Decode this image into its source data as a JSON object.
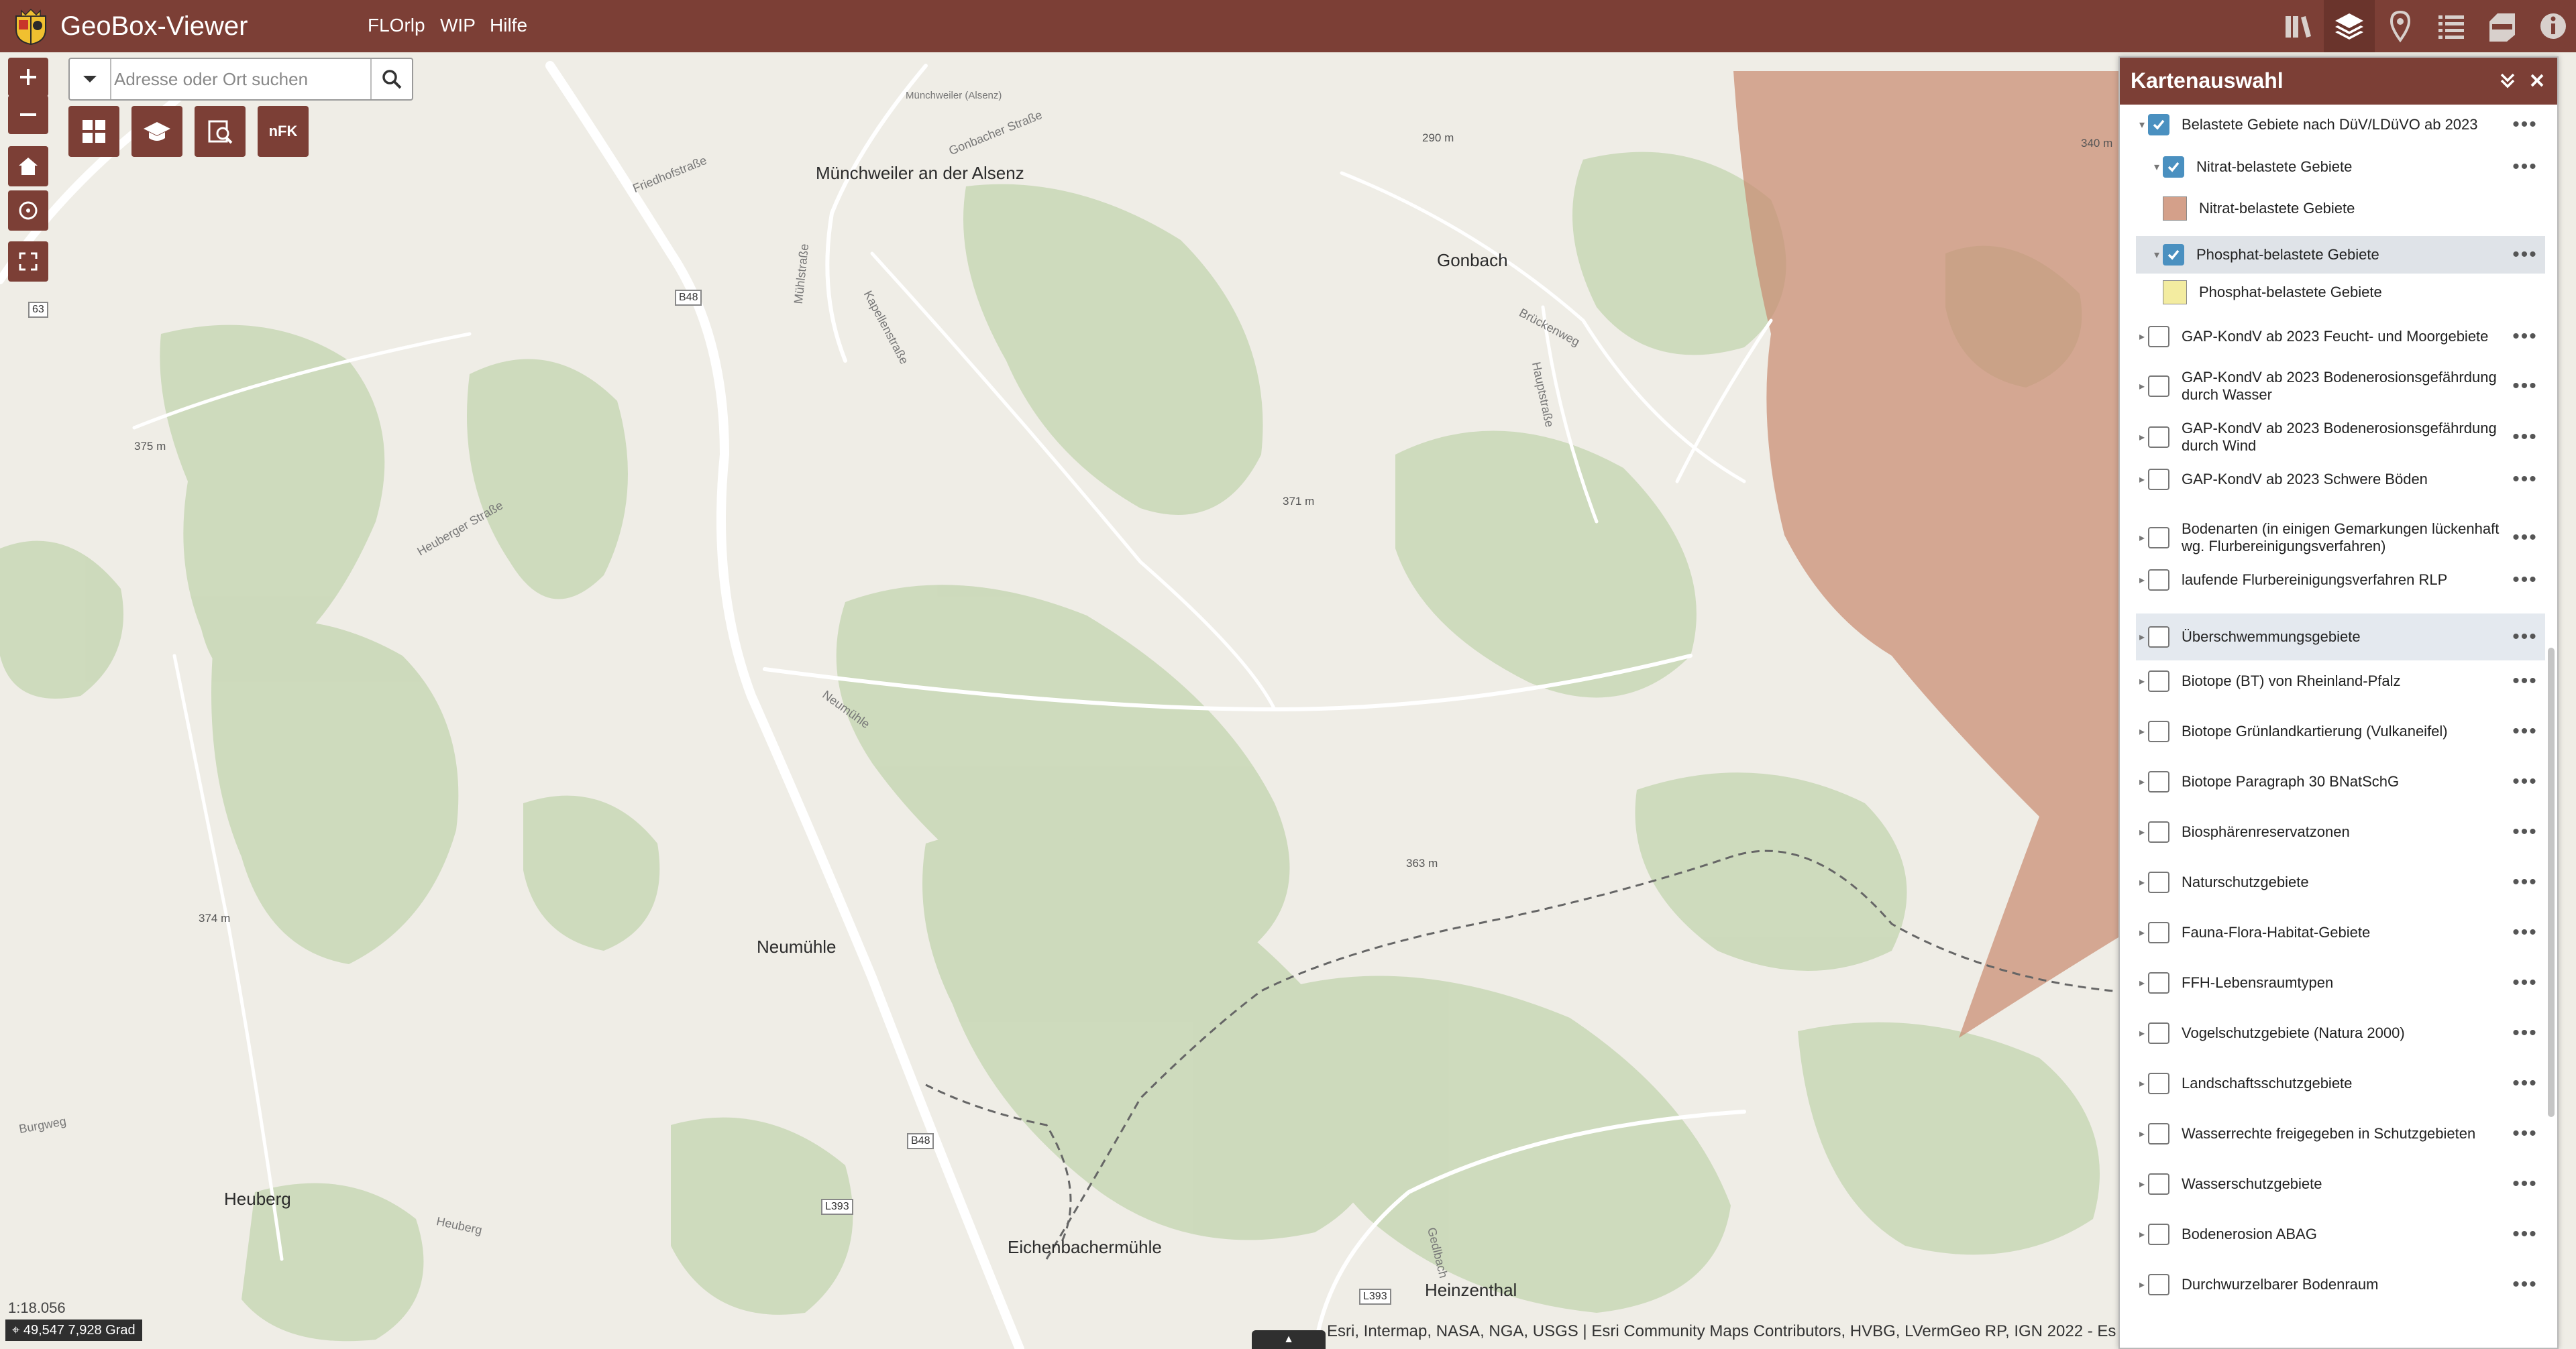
{
  "header": {
    "title": "GeoBox-Viewer",
    "menu": [
      "FLOrlp",
      "WIP",
      "Hilfe"
    ],
    "icons": [
      "library-icon",
      "layers-icon",
      "location-pin-icon",
      "legend-list-icon",
      "print-icon",
      "info-icon"
    ]
  },
  "search": {
    "placeholder": "Adresse oder Ort suchen"
  },
  "tools": {
    "nfk_label": "nFK"
  },
  "map": {
    "scale": "1:18.056",
    "coordinates": "49,547 7,928 Grad",
    "attribution": "Esri, Intermap, NASA, NGA, USGS | Esri Community Maps Contributors, HVBG, LVermGeo RP, IGN 2022 - Es",
    "places": [
      "Münchweiler an der Alsenz",
      "Gonbach",
      "Neumühle",
      "Heuberg",
      "Eichenbachermühle",
      "Heinzenthal"
    ],
    "streets": [
      "Friedhofstraße",
      "Mühlstraße",
      "Kapellenstraße",
      "Gonbacher Straße",
      "Brückenweg",
      "Hauptstraße",
      "Heuberger Straße",
      "Neumühle",
      "Heuberg",
      "Burgweg",
      "Gedlbach"
    ],
    "elevations": [
      "290 m",
      "340 m",
      "375 m",
      "371 m",
      "374 m",
      "363 m"
    ],
    "roads": [
      "B48",
      "63",
      "L393"
    ],
    "village_small_label": "Münchweiler (Alsenz)"
  },
  "panel": {
    "title": "Kartenauswahl",
    "layers": [
      {
        "label": "Belastete Gebiete nach DüV/LDüVO ab 2023",
        "checked": true,
        "level": 0,
        "type": "group"
      },
      {
        "label": "Nitrat-belastete Gebiete",
        "checked": true,
        "level": 1,
        "type": "group"
      },
      {
        "label": "Nitrat-belastete Gebiete",
        "level": 2,
        "type": "legend",
        "color": "#d4a08a"
      },
      {
        "label": "Phosphat-belastete Gebiete",
        "checked": true,
        "level": 1,
        "type": "group",
        "highlight": true
      },
      {
        "label": "Phosphat-belastete Gebiete",
        "level": 2,
        "type": "legend",
        "color": "#f3eca0"
      },
      {
        "label": "GAP-KondV ab 2023 Feucht- und Moorgebiete",
        "checked": false,
        "level": 0
      },
      {
        "label": "GAP-KondV ab 2023 Bodenerosionsgefährdung durch Wasser",
        "checked": false,
        "level": 0
      },
      {
        "label": "GAP-KondV ab 2023 Bodenerosionsgefährdung durch Wind",
        "checked": false,
        "level": 0
      },
      {
        "label": "GAP-KondV ab 2023 Schwere Böden",
        "checked": false,
        "level": 0
      },
      {
        "label": "Bodenarten (in einigen Gemarkungen lückenhaft wg. Flurbereinigungsverfahren)",
        "checked": false,
        "level": 0
      },
      {
        "label": "laufende Flurbereinigungsverfahren RLP",
        "checked": false,
        "level": 0
      },
      {
        "label": "Überschwemmungsgebiete",
        "checked": false,
        "level": 0,
        "highlight": true
      },
      {
        "label": "Biotope (BT) von Rheinland-Pfalz",
        "checked": false,
        "level": 0
      },
      {
        "label": "Biotope Grünlandkartierung (Vulkaneifel)",
        "checked": false,
        "level": 0
      },
      {
        "label": "Biotope Paragraph 30 BNatSchG",
        "checked": false,
        "level": 0
      },
      {
        "label": "Biosphärenreservatzonen",
        "checked": false,
        "level": 0
      },
      {
        "label": "Naturschutzgebiete",
        "checked": false,
        "level": 0
      },
      {
        "label": "Fauna-Flora-Habitat-Gebiete",
        "checked": false,
        "level": 0
      },
      {
        "label": "FFH-Lebensraumtypen",
        "checked": false,
        "level": 0
      },
      {
        "label": "Vogelschutzgebiete (Natura 2000)",
        "checked": false,
        "level": 0
      },
      {
        "label": "Landschaftsschutzgebiete",
        "checked": false,
        "level": 0
      },
      {
        "label": "Wasserrechte freigegeben in Schutzgebieten",
        "checked": false,
        "level": 0
      },
      {
        "label": "Wasserschutzgebiete",
        "checked": false,
        "level": 0
      },
      {
        "label": "Bodenerosion ABAG",
        "checked": false,
        "level": 0
      },
      {
        "label": "Durchwurzelbarer Bodenraum",
        "checked": false,
        "level": 0
      }
    ]
  },
  "colors": {
    "brand": "#7c3f36",
    "nitrat": "#c98c72",
    "check": "#4a90c0"
  }
}
